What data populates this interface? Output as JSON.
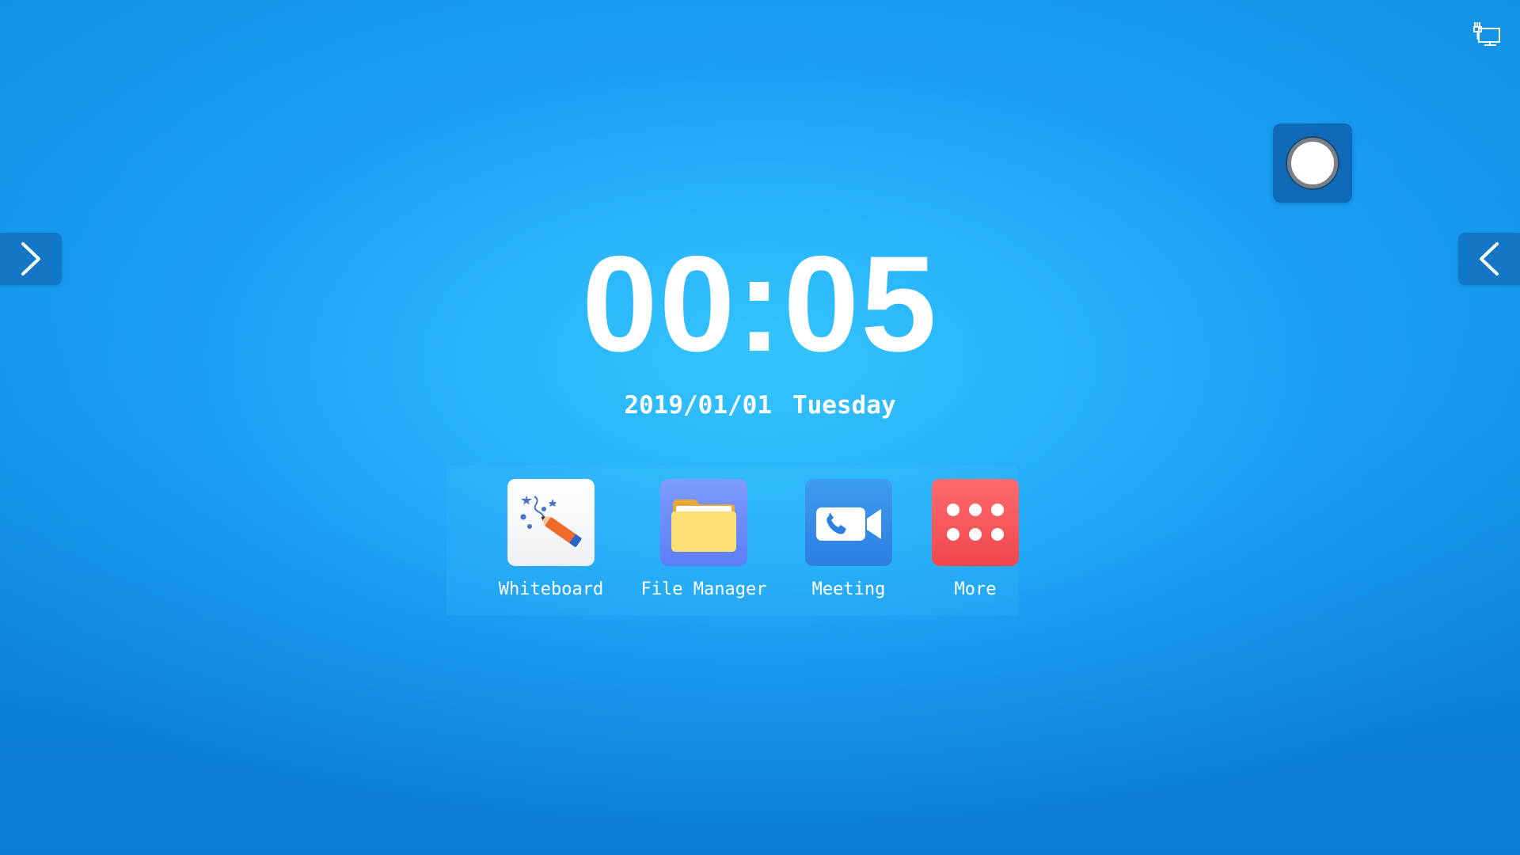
{
  "status_bar": {
    "network_icon": "ethernet-network-icon"
  },
  "record_widget": {
    "icon": "record-circle-icon"
  },
  "side_tabs": {
    "left_icon": "chevron-right-icon",
    "right_icon": "chevron-left-icon"
  },
  "clock": {
    "time": "00:05",
    "date": "2019/01/01",
    "weekday": "Tuesday"
  },
  "apps": [
    {
      "label": "Whiteboard",
      "icon": "whiteboard-pencil-icon",
      "color": "#ffffff"
    },
    {
      "label": "File Manager",
      "icon": "folder-icon",
      "color": "#6b8cfb"
    },
    {
      "label": "Meeting",
      "icon": "video-call-icon",
      "color": "#3590ea"
    },
    {
      "label": "More",
      "icon": "dots-grid-icon",
      "color": "#f75a5e"
    }
  ],
  "colors": {
    "background": "#1aa3f3",
    "side_tab": "#1476c7",
    "record_widget": "#0e69b7",
    "text": "#ffffff"
  }
}
